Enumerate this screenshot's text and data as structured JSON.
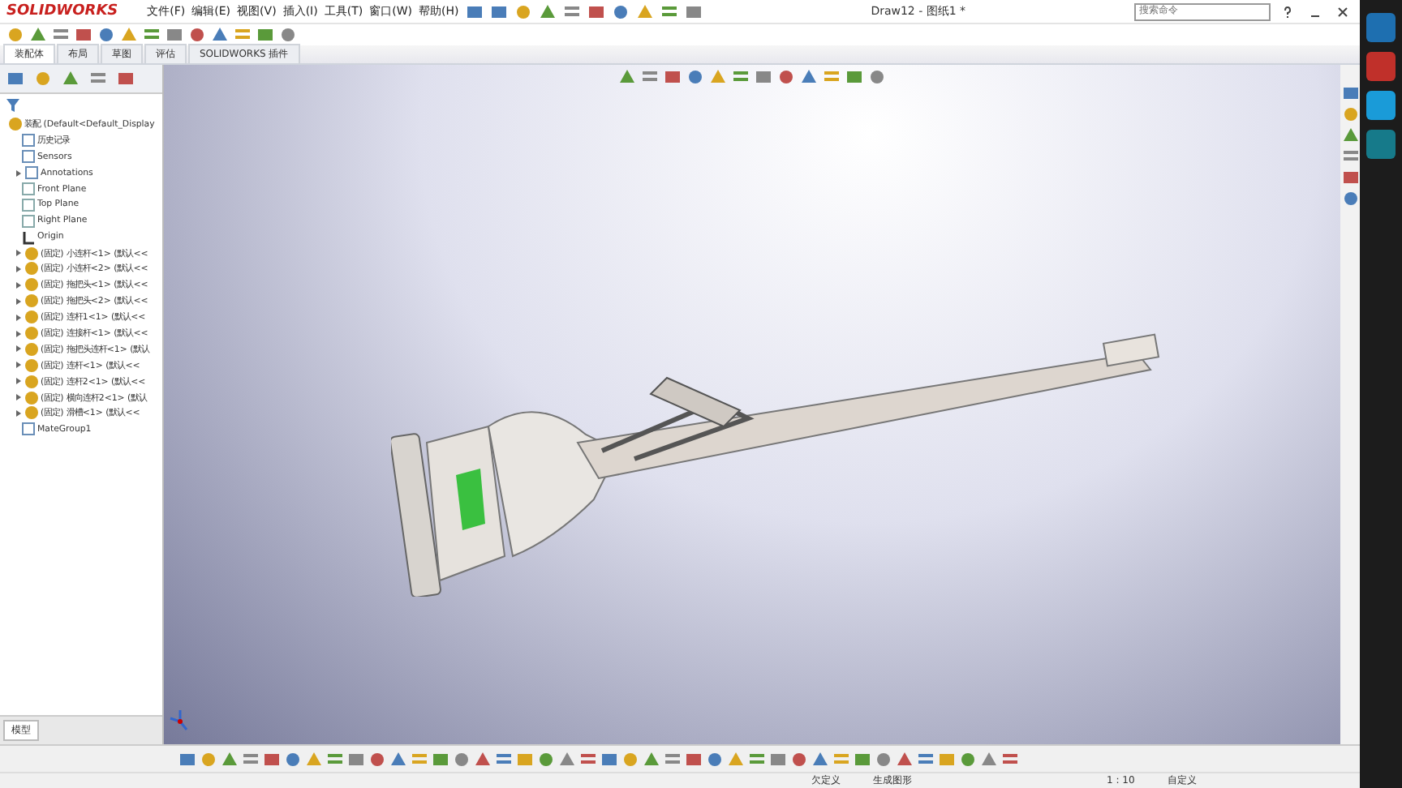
{
  "app": {
    "logo": "SOLIDWORKS",
    "title": "Draw12 - 图纸1 *"
  },
  "menu": [
    "文件(F)",
    "编辑(E)",
    "视图(V)",
    "插入(I)",
    "工具(T)",
    "窗口(W)",
    "帮助(H)"
  ],
  "search": {
    "placeholder": "搜索命令"
  },
  "tabs": [
    {
      "label": "装配体",
      "selected": true
    },
    {
      "label": "布局",
      "selected": false
    },
    {
      "label": "草图",
      "selected": false
    },
    {
      "label": "评估",
      "selected": false
    },
    {
      "label": "SOLIDWORKS 插件",
      "selected": false
    }
  ],
  "tree": [
    {
      "kind": "assembly",
      "label": "装配 (Default<Default_Display",
      "children": [
        {
          "kind": "history",
          "label": "历史记录"
        },
        {
          "kind": "sensor",
          "label": "Sensors"
        },
        {
          "kind": "annotation",
          "label": "Annotations",
          "expanded": false
        },
        {
          "kind": "plane",
          "label": "Front Plane"
        },
        {
          "kind": "plane",
          "label": "Top Plane"
        },
        {
          "kind": "plane",
          "label": "Right Plane"
        },
        {
          "kind": "origin",
          "label": "Origin"
        },
        {
          "kind": "part",
          "label": "(固定) 小连杆<1> (默认<<",
          "expanded": false
        },
        {
          "kind": "part",
          "label": "(固定) 小连杆<2> (默认<<",
          "expanded": false
        },
        {
          "kind": "part",
          "label": "(固定) 拖把头<1> (默认<<",
          "expanded": false
        },
        {
          "kind": "part",
          "label": "(固定) 拖把头<2> (默认<<",
          "expanded": false
        },
        {
          "kind": "part",
          "label": "(固定) 连杆1<1> (默认<<",
          "expanded": false
        },
        {
          "kind": "part",
          "label": "(固定) 连接杆<1> (默认<<",
          "expanded": false
        },
        {
          "kind": "part",
          "label": "(固定) 拖把头连杆<1> (默认",
          "expanded": false
        },
        {
          "kind": "part",
          "label": "(固定) 连杆<1> (默认<<",
          "expanded": false
        },
        {
          "kind": "part",
          "label": "(固定) 连杆2<1> (默认<<",
          "expanded": false
        },
        {
          "kind": "part",
          "label": "(固定) 横向连杆2<1> (默认",
          "expanded": false
        },
        {
          "kind": "part",
          "label": "(固定) 滑槽<1> (默认<<",
          "expanded": false
        },
        {
          "kind": "mates",
          "label": "MateGroup1"
        }
      ]
    }
  ],
  "bottom_tabs": [
    {
      "label": "模型",
      "selected": true
    }
  ],
  "status_bar": [
    "欠定义",
    "生成图形",
    "1 : 10",
    "自定义"
  ]
}
